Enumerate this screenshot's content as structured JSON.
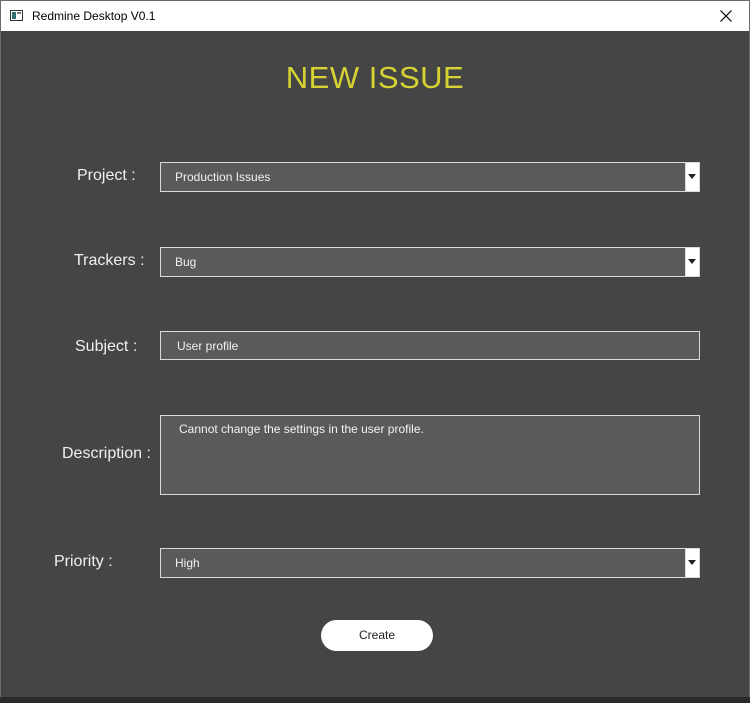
{
  "window": {
    "title": "Redmine Desktop V0.1",
    "icon": "app-window-icon"
  },
  "form": {
    "heading": "NEW ISSUE",
    "project": {
      "label": "Project :",
      "value": "Production Issues"
    },
    "trackers": {
      "label": "Trackers :",
      "value": "Bug"
    },
    "subject": {
      "label": "Subject :",
      "value": "User profile"
    },
    "description": {
      "label": "Description :",
      "value": "Cannot change the settings in the user profile."
    },
    "priority": {
      "label": "Priority :",
      "value": "High"
    },
    "create_label": "Create"
  },
  "colors": {
    "background": "#454545",
    "heading": "#d6d233",
    "field": "#5a5a5a"
  }
}
